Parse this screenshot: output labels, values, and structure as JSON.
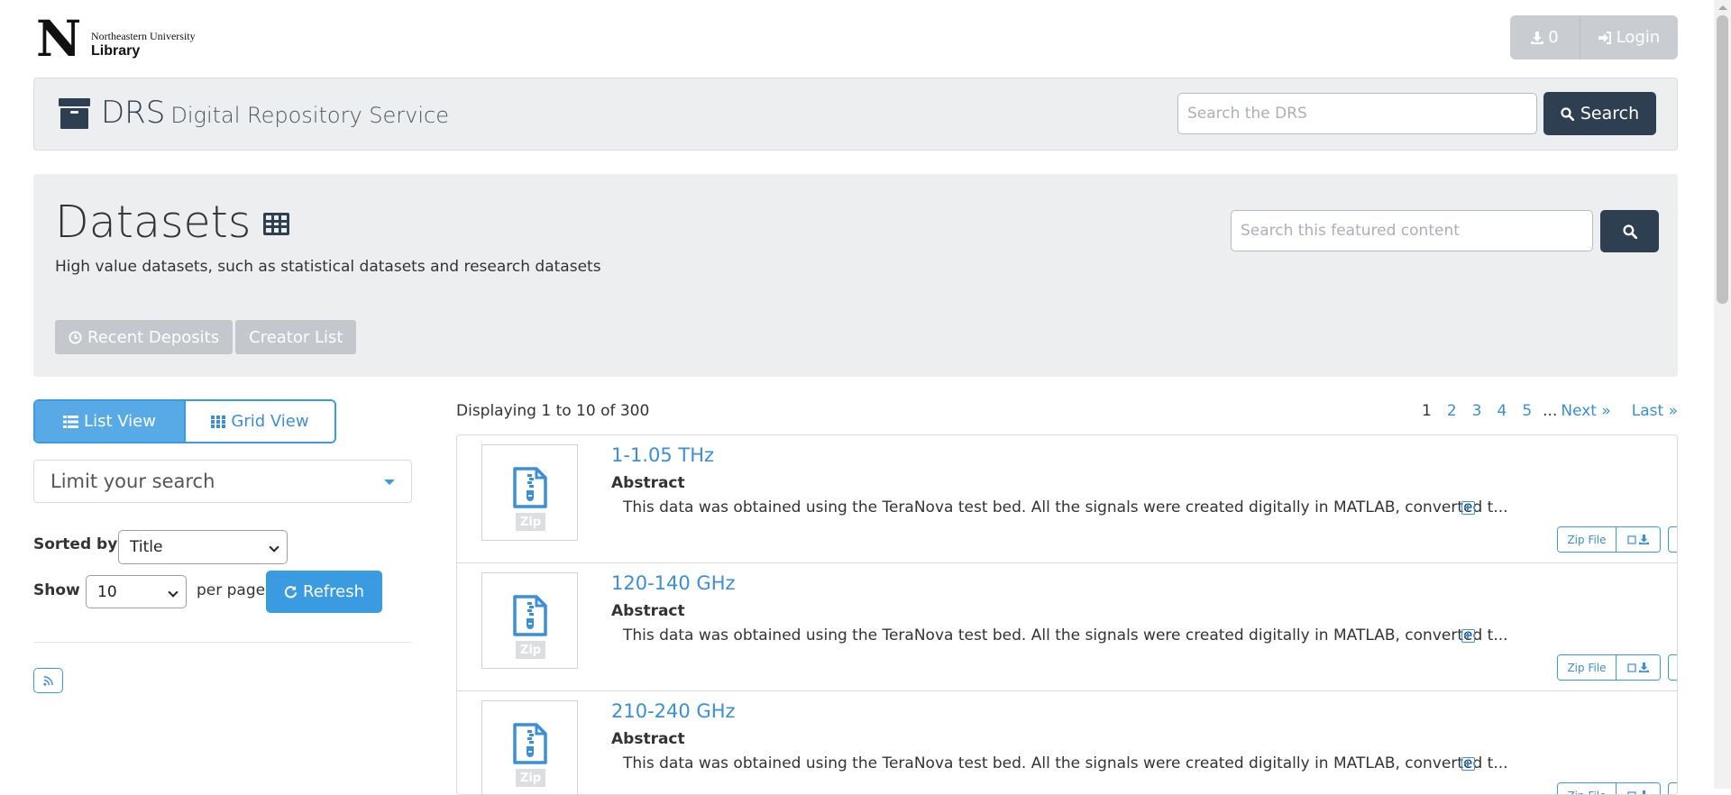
{
  "header": {
    "logo": {
      "letter": "N",
      "university": "Northeastern University",
      "library": "Library"
    },
    "download_count": "0",
    "login_label": "Login"
  },
  "drs": {
    "title": "DRS",
    "subtitle": "Digital Repository Service",
    "search_placeholder": "Search the DRS",
    "search_button": "Search"
  },
  "featured": {
    "title": "Datasets",
    "description": "High value datasets, such as statistical datasets and research datasets",
    "search_placeholder": "Search this featured content",
    "tabs": [
      "Recent Deposits",
      "Creator List"
    ]
  },
  "sidebar": {
    "list_view": "List View",
    "grid_view": "Grid View",
    "limit_label": "Limit your search",
    "sorted_by_label": "Sorted by",
    "sorted_by_value": "Title",
    "show_label": "Show",
    "show_value": "10",
    "per_page_label": "per page",
    "refresh_label": "Refresh"
  },
  "results": {
    "displaying": "Displaying 1 to 10 of 300",
    "pagination": {
      "current": "1",
      "pages": [
        "2",
        "3",
        "4",
        "5"
      ],
      "ellipsis": "...",
      "next": "Next »",
      "last": "Last »"
    },
    "items": [
      {
        "title": "1-1.05 THz",
        "abstract_label": "Abstract",
        "abstract": "This data was obtained using the TeraNova test bed. All the signals were created digitally in MATLAB, converted t...",
        "thumb_label": "Zip",
        "zip_button": "Zip File"
      },
      {
        "title": "120-140 GHz",
        "abstract_label": "Abstract",
        "abstract": "This data was obtained using the TeraNova test bed. All the signals were created digitally in MATLAB, converted t...",
        "thumb_label": "Zip",
        "zip_button": "Zip File"
      },
      {
        "title": "210-240 GHz",
        "abstract_label": "Abstract",
        "abstract": "This data was obtained using the TeraNova test bed. All the signals were created digitally in MATLAB, converted t...",
        "thumb_label": "Zip",
        "zip_button": "Zip File"
      }
    ]
  },
  "colors": {
    "navy": "#2f3f52",
    "link_blue": "#3a8fd6",
    "active_blue": "#58aae6",
    "panel_gray": "#eceeef"
  }
}
